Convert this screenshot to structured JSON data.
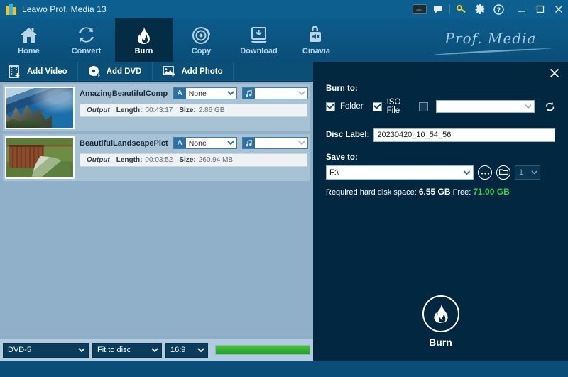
{
  "window": {
    "title": "Leawo Prof. Media 13",
    "logo_icon": "leawo-logo-icon",
    "controls": {
      "gpu_badge_label": "AMD",
      "feedback_icon": "chat-bubble-icon",
      "key_icon": "key-icon",
      "settings_icon": "gear-icon",
      "help_icon": "help-circle-icon",
      "minimize_icon": "minimize-icon",
      "maximize_icon": "maximize-icon",
      "close_icon": "close-icon"
    }
  },
  "nav": {
    "brand": "Prof. Media",
    "tabs": [
      {
        "label": "Home",
        "icon": "home-icon",
        "active": false
      },
      {
        "label": "Convert",
        "icon": "convert-icon",
        "active": false
      },
      {
        "label": "Burn",
        "icon": "flame-icon",
        "active": true
      },
      {
        "label": "Copy",
        "icon": "disc-icon",
        "active": false
      },
      {
        "label": "Download",
        "icon": "download-icon",
        "active": false
      },
      {
        "label": "Cinavia",
        "icon": "unlock-speaker-icon",
        "active": false
      }
    ]
  },
  "toolbar": {
    "add_video": "Add Video",
    "add_video_icon": "film-add-icon",
    "add_dvd": "Add DVD",
    "add_dvd_icon": "disc-add-icon",
    "add_photo": "Add Photo",
    "add_photo_icon": "photo-add-icon"
  },
  "list": {
    "items": [
      {
        "name": "AmazingBeautifulCompil...",
        "thumbnail": "mountain-coast-thumbnail",
        "subtitle_icon": "subtitle-icon",
        "subtitle_value": "None",
        "audio_icon": "audio-track-icon",
        "audio_value": "",
        "output_label": "Output",
        "length_key": "Length:",
        "length_value": "00:43:17",
        "size_key": "Size:",
        "size_value": "2.86 GB"
      },
      {
        "name": "BeautifulLandscapePictur...",
        "thumbnail": "garden-fence-thumbnail",
        "subtitle_icon": "subtitle-icon",
        "subtitle_value": "None",
        "audio_icon": "audio-track-icon",
        "audio_value": "",
        "output_label": "Output",
        "length_key": "Length:",
        "length_value": "00:03:52",
        "size_key": "Size:",
        "size_value": "260.94 MB"
      }
    ]
  },
  "bottom_bar": {
    "disc_type": "DVD-5",
    "quality": "Fit to disc",
    "aspect_ratio": "16:9",
    "progress_percent": 100
  },
  "panel": {
    "close_icon": "close-icon",
    "burn_to_label": "Burn to:",
    "folder_label": "Folder",
    "folder_checked": true,
    "iso_label": "ISO File",
    "iso_checked": true,
    "device_checked": false,
    "device_value": "",
    "refresh_icon": "refresh-icon",
    "disc_label_label": "Disc Label:",
    "disc_label_value": "20230420_10_54_56",
    "save_to_label": "Save to:",
    "save_to_value": "F:\\",
    "browse_icon": "ellipsis-icon",
    "open_folder_icon": "folder-icon",
    "copies_value": "1",
    "space_prefix": "Required hard disk space:",
    "space_required": "6.55 GB",
    "space_free_label": "Free:",
    "space_free": "71.00 GB",
    "burn_button_label": "Burn",
    "burn_button_icon": "flame-icon"
  },
  "colors": {
    "header_blue": "#0a527f",
    "panel_navy": "#012741",
    "list_bg": "#8fb0c8",
    "free_green": "#3ad14f",
    "progress_green": "#2aa83a"
  }
}
